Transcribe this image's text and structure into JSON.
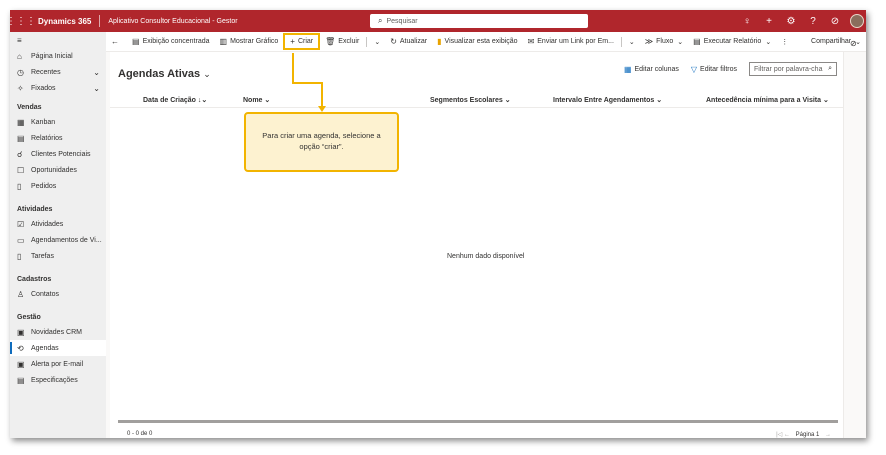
{
  "topbar": {
    "brand": "Dynamics 365",
    "app_title": "Aplicativo Consultor Educacional - Gestor",
    "search_placeholder": "Pesquisar"
  },
  "sidebar": {
    "home": "Página Inicial",
    "recent": "Recentes",
    "pinned": "Fixados",
    "groups": [
      {
        "title": "Vendas",
        "items": [
          "Kanban",
          "Relatórios",
          "Clientes Potenciais",
          "Oportunidades",
          "Pedidos"
        ]
      },
      {
        "title": "Atividades",
        "items": [
          "Atividades",
          "Agendamentos de Vi...",
          "Tarefas"
        ]
      },
      {
        "title": "Cadastros",
        "items": [
          "Contatos"
        ]
      },
      {
        "title": "Gestão",
        "items": [
          "Novidades CRM",
          "Agendas",
          "Alerta por E-mail",
          "Especificações"
        ]
      }
    ]
  },
  "commandbar": {
    "focused_view": "Exibição concentrada",
    "show_chart": "Mostrar Gráfico",
    "new": "Criar",
    "delete": "Excluir",
    "refresh": "Atualizar",
    "visualize": "Visualizar esta exibição",
    "send_link": "Enviar um Link por Em...",
    "flow": "Fluxo",
    "run_report": "Executar Relatório",
    "share": "Compartilhar"
  },
  "grid": {
    "view_name": "Agendas Ativas",
    "edit_columns": "Editar colunas",
    "edit_filters": "Editar filtros",
    "filter_placeholder": "Filtrar por palavra-cha",
    "columns": [
      "Data de Criação",
      "Nome",
      "Segmentos Escolares",
      "Intervalo Entre Agendamentos",
      "Antecedência mínima para a Visita"
    ],
    "empty_message": "Nenhum dado disponível",
    "record_count": "0 - 0 de 0",
    "page_label": "Página 1"
  },
  "annotation": {
    "text": "Para criar uma agenda, selecione a opção “criar”."
  },
  "colors": {
    "topbar": "#b0262c",
    "highlight": "#f2b400",
    "accent": "#0f6cbd"
  }
}
